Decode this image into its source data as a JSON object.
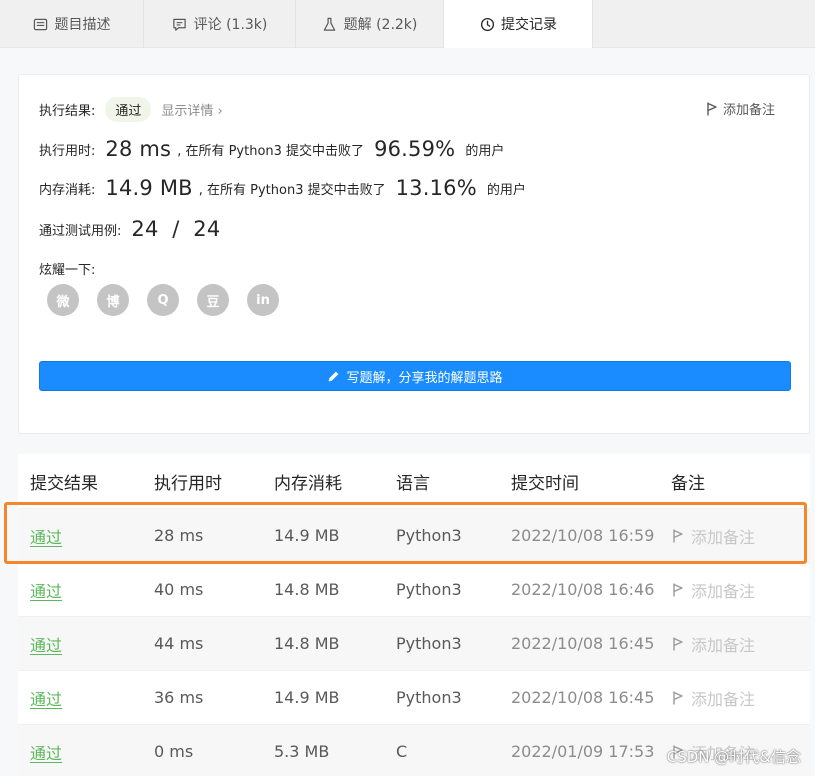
{
  "tabs": [
    {
      "label": "题目描述",
      "icon": "description-icon"
    },
    {
      "label": "评论 (1.3k)",
      "icon": "comment-icon"
    },
    {
      "label": "题解 (2.2k)",
      "icon": "flask-icon"
    },
    {
      "label": "提交记录",
      "icon": "clock-icon"
    }
  ],
  "result": {
    "status_label": "执行结果:",
    "status_value": "通过",
    "detail_link": "显示详情 ›",
    "add_note": "添加备注",
    "runtime_label": "执行用时:",
    "runtime_value": "28 ms",
    "runtime_beat_text": ", 在所有 Python3 提交中击败了",
    "runtime_percent": "96.59%",
    "runtime_suffix": "的用户",
    "memory_label": "内存消耗:",
    "memory_value": "14.9 MB",
    "memory_beat_text": ", 在所有 Python3 提交中击败了",
    "memory_percent": "13.16%",
    "memory_suffix": "的用户",
    "tests_label": "通过测试用例:",
    "tests_value": "24  /  24",
    "share_label": "炫耀一下:",
    "share_button": "写题解，分享我的解题思路"
  },
  "social": [
    {
      "name": "wechat-icon",
      "glyph": "微"
    },
    {
      "name": "weibo-icon",
      "glyph": "博"
    },
    {
      "name": "qq-icon",
      "glyph": "Q"
    },
    {
      "name": "douban-icon",
      "glyph": "豆"
    },
    {
      "name": "linkedin-icon",
      "glyph": "in"
    }
  ],
  "table": {
    "headers": [
      "提交结果",
      "执行用时",
      "内存消耗",
      "语言",
      "提交时间",
      "备注"
    ],
    "rows": [
      {
        "status": "通过",
        "runtime": "28 ms",
        "memory": "14.9 MB",
        "language": "Python3",
        "time": "2022/10/08 16:59",
        "note": "添加备注"
      },
      {
        "status": "通过",
        "runtime": "40 ms",
        "memory": "14.8 MB",
        "language": "Python3",
        "time": "2022/10/08 16:46",
        "note": "添加备注"
      },
      {
        "status": "通过",
        "runtime": "44 ms",
        "memory": "14.8 MB",
        "language": "Python3",
        "time": "2022/10/08 16:45",
        "note": "添加备注"
      },
      {
        "status": "通过",
        "runtime": "36 ms",
        "memory": "14.9 MB",
        "language": "Python3",
        "time": "2022/10/08 16:45",
        "note": "添加备注"
      },
      {
        "status": "通过",
        "runtime": "0 ms",
        "memory": "5.3 MB",
        "language": "C",
        "time": "2022/01/09 17:53",
        "note": "添加备注"
      }
    ]
  },
  "watermark": "CSDN @时代&信念",
  "colors": {
    "accent": "#1a8cff",
    "success": "#5cb85c",
    "highlight": "#f5862b"
  }
}
